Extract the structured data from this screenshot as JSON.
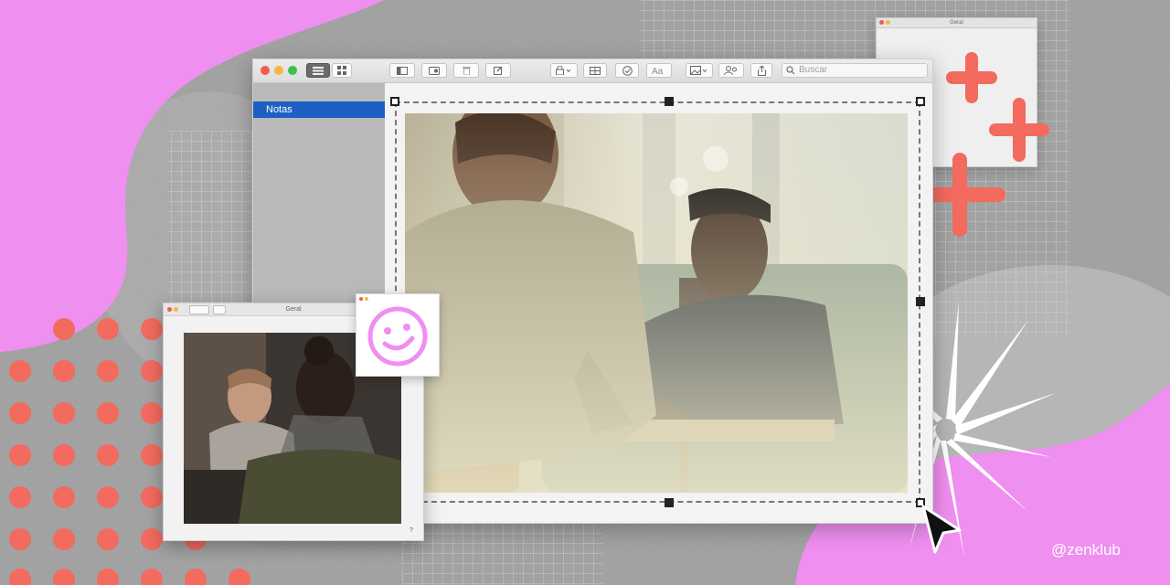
{
  "main_window": {
    "sidebar": {
      "items": [
        {
          "label": "Notas",
          "selected": true
        }
      ]
    },
    "search": {
      "placeholder": "Buscar"
    },
    "toolbar": {
      "icons": [
        "sidebar-list-icon",
        "grid-icon",
        "panel-icon",
        "media-icon",
        "trash-icon",
        "compose-icon",
        "lock-icon",
        "table-icon",
        "checklist-icon",
        "text-format-icon",
        "image-icon",
        "collaborate-icon",
        "share-icon",
        "search-icon"
      ]
    }
  },
  "small_window": {
    "title": "Geral"
  },
  "photo_window": {
    "title": "Geral",
    "help": "?"
  },
  "brand": {
    "handle": "@zenklub"
  },
  "colors": {
    "pink": "#ef8ff0",
    "coral": "#f36a5f",
    "selection_blue": "#1d5fc4",
    "grey_bg": "#9a9a9a"
  }
}
